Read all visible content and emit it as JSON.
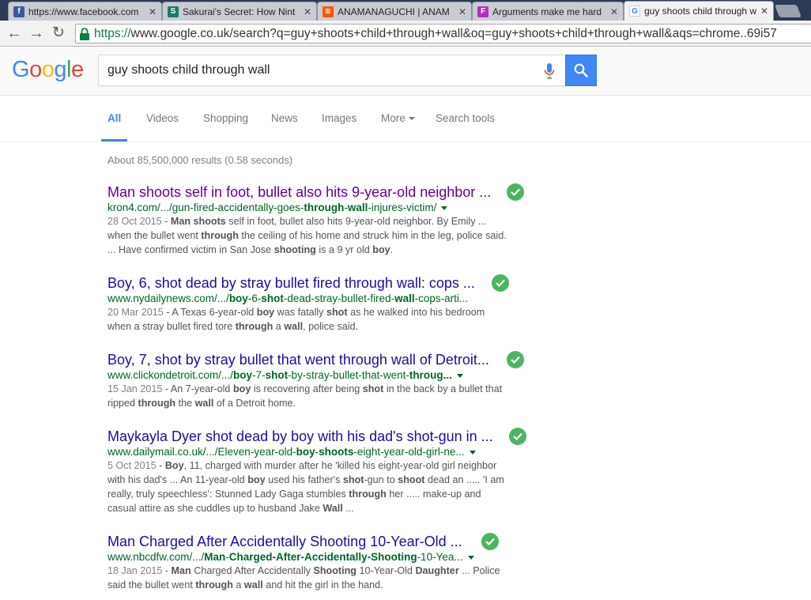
{
  "browser": {
    "tabs": [
      {
        "title": "https://www.facebook.com",
        "favicon": "facebook-icon",
        "color": "#3b5998",
        "glyph": "f"
      },
      {
        "title": "Sakurai's Secret: How Nint",
        "favicon": "sakurai-icon",
        "color": "#1a7a6a",
        "glyph": "S"
      },
      {
        "title": "ANAMANAGUCHI | ANAM",
        "favicon": "soundcloud-icon",
        "color": "#ff5500",
        "glyph": "≋"
      },
      {
        "title": "Arguments make me hard",
        "favicon": "tumblr-icon",
        "color": "#b22fc1",
        "glyph": "F"
      },
      {
        "title": "guy shoots child through w",
        "favicon": "google-icon",
        "color": "#ffffff",
        "glyph": "G"
      }
    ],
    "url_secure": "https://",
    "url_rest": "www.google.co.uk/search?q=guy+shoots+child+through+wall&oq=guy+shoots+child+through+wall&aqs=chrome..69i57"
  },
  "google": {
    "logo_letters": [
      {
        "ch": "G",
        "color": "#4285f4"
      },
      {
        "ch": "o",
        "color": "#ea4335"
      },
      {
        "ch": "o",
        "color": "#fbbc05"
      },
      {
        "ch": "g",
        "color": "#4285f4"
      },
      {
        "ch": "l",
        "color": "#34a853"
      },
      {
        "ch": "e",
        "color": "#ea4335"
      }
    ],
    "query": "guy shoots child through wall",
    "nav": {
      "all": "All",
      "videos": "Videos",
      "shopping": "Shopping",
      "news": "News",
      "images": "Images",
      "more": "More",
      "tools": "Search tools"
    },
    "stats": "About 85,500,000 results (0.58 seconds)"
  },
  "results": [
    {
      "title": "Man shoots self in foot, bullet also hits 9-year-old neighbor ...",
      "visited": true,
      "url_parts": [
        {
          "t": "kron4.com/.../gun-fired-accidentally-goes-",
          "b": false
        },
        {
          "t": "through",
          "b": true
        },
        {
          "t": "-",
          "b": false
        },
        {
          "t": "wall",
          "b": true
        },
        {
          "t": "-injures-victim/",
          "b": false
        }
      ],
      "date": "28 Oct 2015",
      "snippet_parts": [
        {
          "t": " - ",
          "b": false
        },
        {
          "t": "Man shoots",
          "b": true
        },
        {
          "t": " self in foot, bullet also hits 9-year-old neighbor. By Emily ... when the bullet went ",
          "b": false
        },
        {
          "t": "through",
          "b": true
        },
        {
          "t": " the ceiling of his home and struck him in the leg, police said. ... Have confirmed victim in San Jose ",
          "b": false
        },
        {
          "t": "shooting",
          "b": true
        },
        {
          "t": " is a 9 yr old ",
          "b": false
        },
        {
          "t": "boy",
          "b": true
        },
        {
          "t": ".",
          "b": false
        }
      ]
    },
    {
      "title": "Boy, 6, shot dead by stray bullet fired through wall: cops ...",
      "visited": false,
      "url_parts": [
        {
          "t": "www.nydailynews.com/.../",
          "b": false
        },
        {
          "t": "boy",
          "b": true
        },
        {
          "t": "-6-",
          "b": false
        },
        {
          "t": "shot",
          "b": true
        },
        {
          "t": "-dead-stray-bullet-fired-",
          "b": false
        },
        {
          "t": "wall",
          "b": true
        },
        {
          "t": "-cops-arti...",
          "b": false
        }
      ],
      "date": "20 Mar 2015",
      "snippet_parts": [
        {
          "t": " - A Texas 6-year-old ",
          "b": false
        },
        {
          "t": "boy",
          "b": true
        },
        {
          "t": " was fatally ",
          "b": false
        },
        {
          "t": "shot",
          "b": true
        },
        {
          "t": " as he walked into his bedroom when a stray bullet fired tore ",
          "b": false
        },
        {
          "t": "through",
          "b": true
        },
        {
          "t": " a ",
          "b": false
        },
        {
          "t": "wall",
          "b": true
        },
        {
          "t": ", police said.",
          "b": false
        }
      ]
    },
    {
      "title": "Boy, 7, shot by stray bullet that went through wall of Detroit...",
      "visited": false,
      "url_parts": [
        {
          "t": "www.clickondetroit.com/.../",
          "b": false
        },
        {
          "t": "boy",
          "b": true
        },
        {
          "t": "-7-",
          "b": false
        },
        {
          "t": "shot",
          "b": true
        },
        {
          "t": "-by-stray-bullet-that-went-",
          "b": false
        },
        {
          "t": "throug...",
          "b": true
        }
      ],
      "date": "15 Jan 2015",
      "snippet_parts": [
        {
          "t": " - An 7-year-old ",
          "b": false
        },
        {
          "t": "boy",
          "b": true
        },
        {
          "t": " is recovering after being ",
          "b": false
        },
        {
          "t": "shot",
          "b": true
        },
        {
          "t": " in the back by a bullet that ripped ",
          "b": false
        },
        {
          "t": "through",
          "b": true
        },
        {
          "t": " the ",
          "b": false
        },
        {
          "t": "wall",
          "b": true
        },
        {
          "t": " of a Detroit home.",
          "b": false
        }
      ]
    },
    {
      "title": "Maykayla Dyer shot dead by boy with his dad's shot-gun in ...",
      "visited": false,
      "url_parts": [
        {
          "t": "www.dailymail.co.uk/.../Eleven-year-old-",
          "b": false
        },
        {
          "t": "boy",
          "b": true
        },
        {
          "t": "-",
          "b": false
        },
        {
          "t": "shoots",
          "b": true
        },
        {
          "t": "-eight-year-old-girl-ne...",
          "b": false
        }
      ],
      "date": "5 Oct 2015",
      "snippet_parts": [
        {
          "t": " - ",
          "b": false
        },
        {
          "t": "Boy",
          "b": true
        },
        {
          "t": ", 11, charged with murder after he 'killed his eight-year-old girl neighbor with his dad's ... An 11-year-old ",
          "b": false
        },
        {
          "t": "boy",
          "b": true
        },
        {
          "t": " used his father's ",
          "b": false
        },
        {
          "t": "shot",
          "b": true
        },
        {
          "t": "-gun to ",
          "b": false
        },
        {
          "t": "shoot",
          "b": true
        },
        {
          "t": " dead an ..... 'I am really, truly speechless': Stunned Lady Gaga stumbles ",
          "b": false
        },
        {
          "t": "through",
          "b": true
        },
        {
          "t": " her ..... make-up and casual attire as she cuddles up to husband Jake ",
          "b": false
        },
        {
          "t": "Wall",
          "b": true
        },
        {
          "t": " ...",
          "b": false
        }
      ]
    },
    {
      "title": "Man Charged After Accidentally Shooting 10-Year-Old ...",
      "visited": false,
      "url_parts": [
        {
          "t": "www.nbcdfw.com/.../",
          "b": false
        },
        {
          "t": "Man",
          "b": true
        },
        {
          "t": "-",
          "b": false
        },
        {
          "t": "Charged-After-Accidentally-",
          "b": true
        },
        {
          "t": "Shooting",
          "b": true
        },
        {
          "t": "-10-Yea...",
          "b": false
        }
      ],
      "date": "18 Jan 2015",
      "snippet_parts": [
        {
          "t": " - ",
          "b": false
        },
        {
          "t": "Man",
          "b": true
        },
        {
          "t": " Charged After Accidentally ",
          "b": false
        },
        {
          "t": "Shooting",
          "b": true
        },
        {
          "t": " 10-Year-Old ",
          "b": false
        },
        {
          "t": "Daughter",
          "b": true
        },
        {
          "t": " ... Police said the bullet went ",
          "b": false
        },
        {
          "t": "through",
          "b": true
        },
        {
          "t": " a ",
          "b": false
        },
        {
          "t": "wall",
          "b": true
        },
        {
          "t": " and hit the girl in the hand.",
          "b": false
        }
      ]
    }
  ]
}
